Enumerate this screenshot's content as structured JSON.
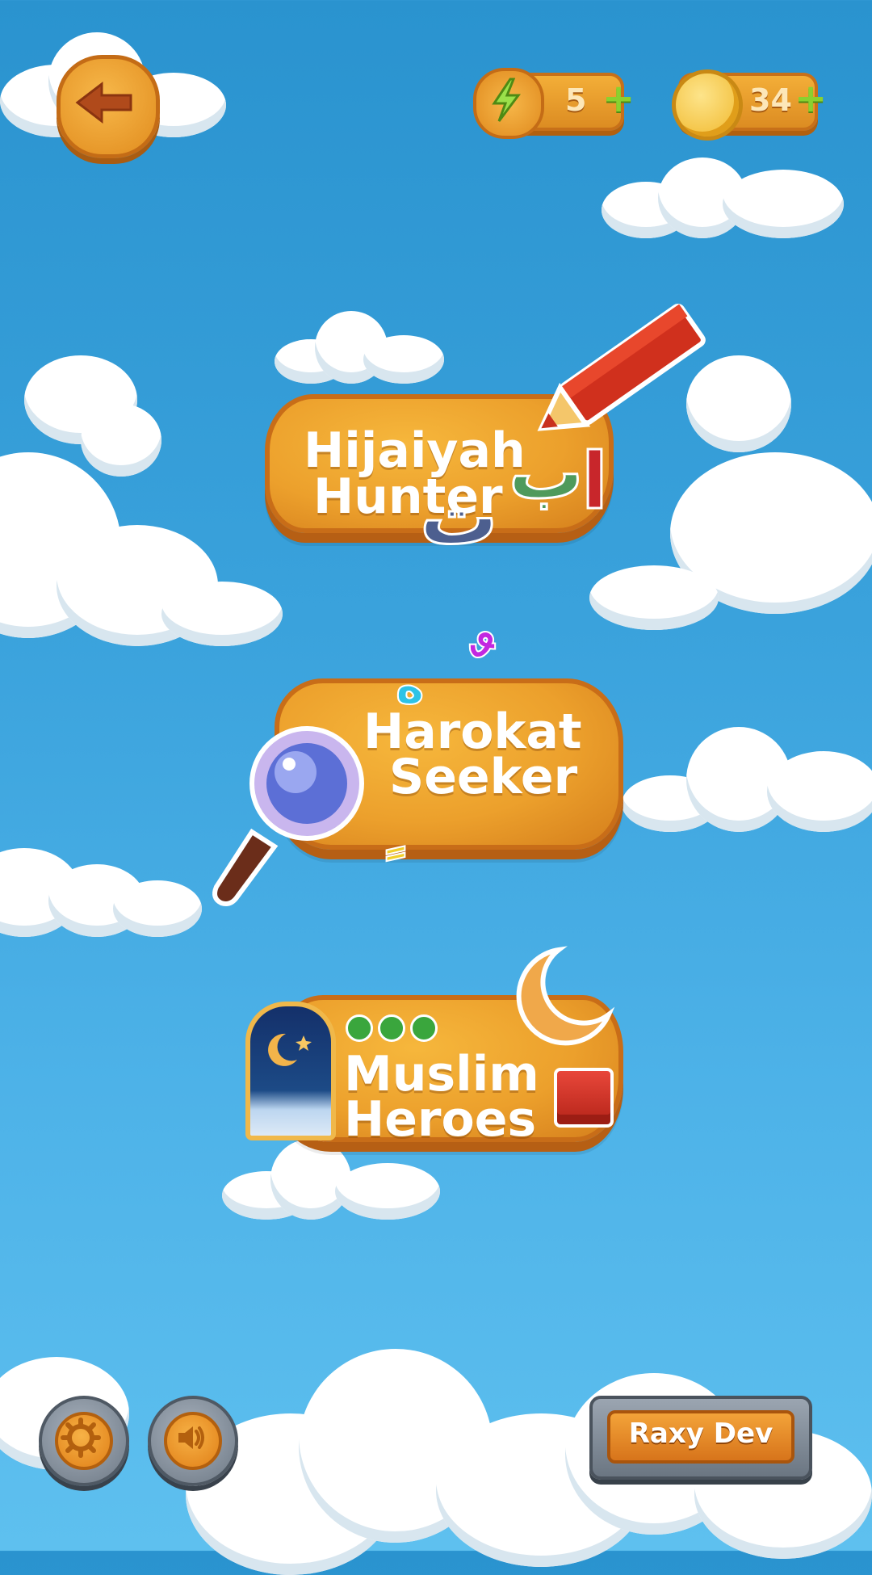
{
  "hud": {
    "back_icon": "back-arrow-icon",
    "energy": {
      "icon": "lightning-icon",
      "value": "5",
      "plus": "+"
    },
    "coins": {
      "icon": "coin-icon",
      "value": "34",
      "plus": "+"
    }
  },
  "menu": [
    {
      "line1": "Hijaiyah",
      "line2": "Hunter",
      "icon": "pencil-icon",
      "letters": [
        "ب",
        "ا",
        "ت"
      ]
    },
    {
      "line1": "Harokat",
      "line2": "Seeker",
      "icon": "magnifier-icon",
      "marks": [
        "ه",
        "ٌ",
        "ٍ"
      ]
    },
    {
      "line1": "Muslim",
      "line2": "Heroes",
      "icon": "mosque-window-icon"
    }
  ],
  "footer": {
    "settings_icon": "gear-icon",
    "sound_icon": "speaker-icon",
    "credit": "Raxy Dev"
  },
  "colors": {
    "sky_top": "#2a93cf",
    "wood": "#eca02c",
    "wood_border": "#c86d18",
    "plus_green": "#8ad12f"
  }
}
